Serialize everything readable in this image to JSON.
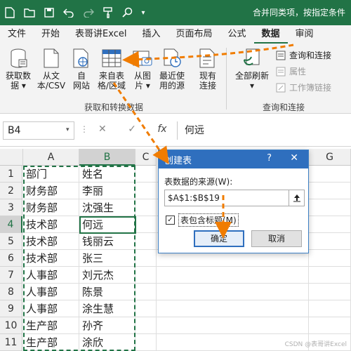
{
  "titlebar": {
    "icons": [
      "file-icon",
      "folder-icon",
      "save-icon",
      "undo-icon",
      "redo-icon",
      "format-painter-icon",
      "search-icon"
    ],
    "right_text": "合并同类项，按指定条件"
  },
  "menu": {
    "items": [
      "文件",
      "开始",
      "表哥讲Excel",
      "插入",
      "页面布局",
      "公式",
      "数据",
      "审阅"
    ],
    "active": "数据"
  },
  "ribbon": {
    "buttons": [
      {
        "label1": "获取数",
        "label2": "据 ▾",
        "icon": "database-icon"
      },
      {
        "label1": "从文",
        "label2": "本/CSV",
        "icon": "text-file-icon"
      },
      {
        "label1": "自",
        "label2": "网站",
        "icon": "web-icon"
      },
      {
        "label1": "来自表",
        "label2": "格/区域",
        "icon": "table-icon"
      },
      {
        "label1": "从图",
        "label2": "片 ▾",
        "icon": "picture-icon"
      },
      {
        "label1": "最近使",
        "label2": "用的源",
        "icon": "recent-sources-icon"
      },
      {
        "label1": "现有",
        "label2": "连接",
        "icon": "existing-connections-icon"
      },
      {
        "label1": "全部刷新",
        "label2": "▾",
        "icon": "refresh-all-icon"
      }
    ],
    "small_buttons": [
      {
        "label": "查询和连接",
        "icon": "queries-icon",
        "enabled": true
      },
      {
        "label": "属性",
        "icon": "properties-icon",
        "enabled": false
      },
      {
        "label": "工作簿链接",
        "icon": "workbook-links-icon",
        "enabled": false
      }
    ],
    "groups": [
      "获取和转换数据",
      "查询和连接"
    ]
  },
  "formula_bar": {
    "name_box": "B4",
    "cancel": "✕",
    "confirm": "✓",
    "fx": "fx",
    "value": "何远"
  },
  "grid": {
    "columns": [
      "A",
      "B",
      "C",
      "G"
    ],
    "selected_column": "B",
    "selected_row": "4",
    "rows": [
      {
        "num": "1",
        "a": "部门",
        "b": "姓名"
      },
      {
        "num": "2",
        "a": "财务部",
        "b": "李丽"
      },
      {
        "num": "3",
        "a": "财务部",
        "b": "沈强生"
      },
      {
        "num": "4",
        "a": "技术部",
        "b": "何远"
      },
      {
        "num": "5",
        "a": "技术部",
        "b": "钱丽云"
      },
      {
        "num": "6",
        "a": "技术部",
        "b": "张三"
      },
      {
        "num": "7",
        "a": "人事部",
        "b": "刘元杰"
      },
      {
        "num": "8",
        "a": "人事部",
        "b": "陈景"
      },
      {
        "num": "9",
        "a": "人事部",
        "b": "涂生慧"
      },
      {
        "num": "10",
        "a": "生产部",
        "b": "孙齐"
      },
      {
        "num": "11",
        "a": "生产部",
        "b": "涂欣"
      }
    ]
  },
  "dialog": {
    "title": "创建表",
    "help": "?",
    "close": "✕",
    "source_label": "表数据的来源(W):",
    "source_value": "$A$1:$B$19",
    "has_headers_label": "表包含标题(M)",
    "has_headers_checked": true,
    "ok": "确定",
    "cancel": "取消"
  },
  "colors": {
    "excel_green": "#217346",
    "arrow_orange": "#f07c00",
    "dialog_blue": "#2f6fbe"
  },
  "watermark": "CSDN @表哥讲Excel"
}
